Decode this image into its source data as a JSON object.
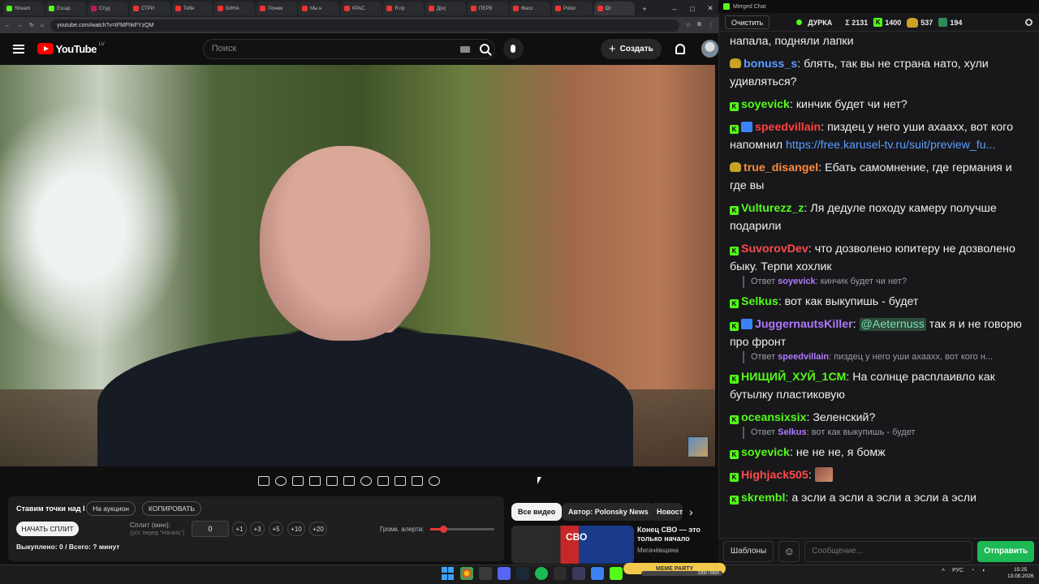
{
  "browser": {
    "tabs": [
      {
        "label": "Stream",
        "color": "g"
      },
      {
        "label": "Escap",
        "color": "g"
      },
      {
        "label": "Студ",
        "color": "p"
      },
      {
        "label": "СТРИ",
        "color": "r"
      },
      {
        "label": "Тебя",
        "color": "r"
      },
      {
        "label": "БИНА",
        "color": "r"
      },
      {
        "label": "Почем",
        "color": "r"
      },
      {
        "label": "Мы н",
        "color": "r"
      },
      {
        "label": "КРАС",
        "color": "r"
      },
      {
        "label": "Я пр",
        "color": "r"
      },
      {
        "label": "Д(и)",
        "color": "r"
      },
      {
        "label": "ПЕРВ",
        "color": "r"
      },
      {
        "label": "Фасо",
        "color": "r"
      },
      {
        "label": "Polon",
        "color": "r"
      },
      {
        "label": "Сг",
        "color": "r"
      }
    ],
    "url": "youtube.com/watch?v=tFMFhkFYzQM"
  },
  "youtube": {
    "logo_text": "YouTube",
    "country_code": "LV",
    "search_placeholder": "Поиск",
    "create_label": "Создать"
  },
  "alert_panel": {
    "title": "Ставим точки над I",
    "auction_label": "На аукцион",
    "copy_label": "КОПИРОВАТЬ",
    "start_label": "НАЧАТЬ СПЛИТ",
    "split_label": "Сплит (мин):",
    "split_hint": "(уст. перед \"Начать\")",
    "split_value": "0",
    "steps": [
      "+1",
      "+3",
      "+5",
      "+10",
      "+20"
    ],
    "volume_label": "Громк. алерта:",
    "volume_level": 0.2,
    "bought": "Выкуплено: 0 / Всего: ? минут"
  },
  "recommendations": {
    "chips": [
      "Все видео",
      "Автор: Polonsky News",
      "Новости"
    ],
    "video": {
      "thumb_text": "СВО",
      "title": "Конец СВО — это только начало",
      "channel": "Мигачёвщина"
    }
  },
  "chat": {
    "window_title": "Merged Chat",
    "clear_label": "Очистить",
    "streamer": "ДУРКА",
    "total_viewers": "Σ 2131",
    "kick_viewers": "1400",
    "other_viewers": "537",
    "fourth_viewers": "194",
    "messages": [
      {
        "kind": "msg",
        "badges": [],
        "user": "",
        "color": "#efeff1",
        "text": "напала, подняли лапки"
      },
      {
        "kind": "msg",
        "badges": [
          "u"
        ],
        "user": "bonuss_s",
        "color": "#5c9dff",
        "text": "блять, так  вы не страна нато, хули удивляться?"
      },
      {
        "kind": "msg",
        "badges": [
          "k"
        ],
        "user": "soyevick",
        "color": "#53fc18",
        "text": "кинчик будет чи нет?"
      },
      {
        "kind": "msg",
        "badges": [
          "k",
          "p"
        ],
        "user": "speedvillain",
        "color": "#ff4040",
        "text": "пиздец у него уши ахаахх, вот кого напомнил ",
        "link": "https://free.karusel-tv.ru/suit/preview_fu..."
      },
      {
        "kind": "msg",
        "badges": [
          "u"
        ],
        "user": "true_disangel",
        "color": "#ff8a3c",
        "text": "Ебать самомнение, где германия и где вы"
      },
      {
        "kind": "msg",
        "badges": [
          "k"
        ],
        "user": "Vulturezz_z",
        "color": "#53fc18",
        "text": "Ля дедуле походу камеру получше подарили"
      },
      {
        "kind": "msg",
        "badges": [
          "k"
        ],
        "user": "SuvorovDev",
        "color": "#ff4a4a",
        "text": "что дозволено юпитеру не дозволено быку. Терпи хохлик"
      },
      {
        "kind": "reply",
        "prefix": "Ответ",
        "user": "soyevick",
        "text": "кинчик будет чи нет?"
      },
      {
        "kind": "msg",
        "badges": [
          "k"
        ],
        "user": "Selkus",
        "color": "#53fc18",
        "text": "вот как выкупишь - будет"
      },
      {
        "kind": "msg",
        "badges": [
          "k",
          "p"
        ],
        "user": "JuggernautsKiller",
        "color": "#b07aff",
        "mention": "@Aeternuss",
        "text": " так я и не говорю про фронт"
      },
      {
        "kind": "reply",
        "prefix": "Ответ",
        "user": "speedvillain",
        "text": "пиздец у него уши ахаахх, вот кого н..."
      },
      {
        "kind": "msg",
        "badges": [
          "k"
        ],
        "user": "НИЩИЙ_ХУЙ_1СМ",
        "color": "#53fc18",
        "text": "На солнце расплаивло как бутылку пластиковую"
      },
      {
        "kind": "msg",
        "badges": [
          "k"
        ],
        "user": "oceansixsix",
        "color": "#53fc18",
        "text": "Зеленский?"
      },
      {
        "kind": "reply",
        "prefix": "Ответ",
        "user": "Selkus",
        "text": "вот как выкупишь - будет"
      },
      {
        "kind": "msg",
        "badges": [
          "k"
        ],
        "user": "soyevick",
        "color": "#53fc18",
        "text": "не не не, я бомж"
      },
      {
        "kind": "msg",
        "badges": [
          "k"
        ],
        "user": "Highjack505",
        "color": "#ff4a4a",
        "text": "",
        "emote": true
      },
      {
        "kind": "msg",
        "badges": [
          "k"
        ],
        "user": "skrembl",
        "color": "#53fc18",
        "text": "а эсли а эсли а эсли а эсли а эсли"
      }
    ],
    "templates_label": "Шаблоны",
    "input_placeholder": "Сообщение...",
    "send_label": "Отправить"
  },
  "taskbar": {
    "meme_party": "MEME PARTY",
    "meme_progress": "1200 / 5500",
    "lang": "РУС",
    "time": "15:25",
    "date": "13.08.2026"
  }
}
